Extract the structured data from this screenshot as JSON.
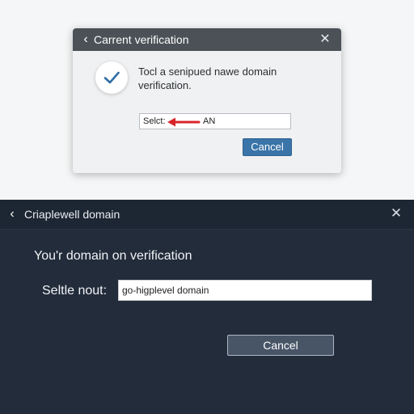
{
  "top_dialog": {
    "title": "Carrent verification",
    "message": "Tocl a senipued nawe domain verification.",
    "select_label": "Selct:",
    "select_value": "AN",
    "cancel_label": "Cancel",
    "icons": {
      "back": "chevron-left-icon",
      "close": "close-icon",
      "status": "checkmark-icon",
      "pointer": "red-arrow-icon"
    },
    "colors": {
      "titlebar": "#4b5157",
      "checkmark": "#2f6ea5",
      "arrow": "#d9252a",
      "button": "#3a74a8"
    }
  },
  "bottom_dialog": {
    "title": "Criaplewell domain",
    "heading": "You'r domain on verification",
    "field_label": "Seltle nout:",
    "field_value": "go-higplevel domain",
    "cancel_label": "Cancel",
    "icons": {
      "back": "chevron-left-icon",
      "close": "close-icon"
    },
    "colors": {
      "background": "#222c3a",
      "button": "#485567"
    }
  }
}
